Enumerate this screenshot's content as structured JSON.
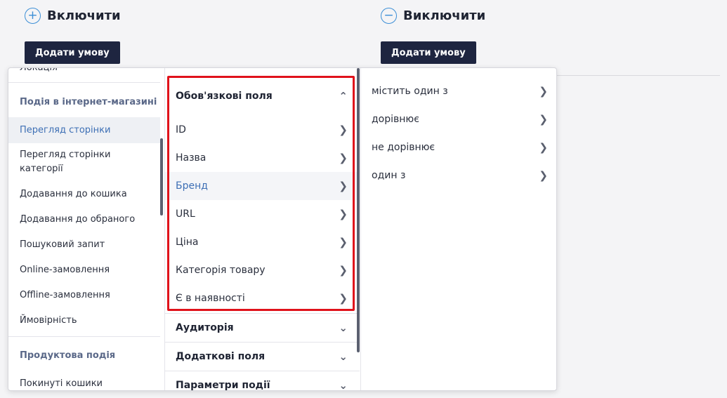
{
  "include": {
    "icon": "plus-circle-icon",
    "title": "Включити",
    "button": "Додати умову"
  },
  "exclude": {
    "icon": "minus-circle-icon",
    "title": "Виключити",
    "button": "Додати умову"
  },
  "column1": {
    "partial_top": "Локація",
    "group1": "Подія в інтернет-магазині",
    "items": [
      "Перегляд сторінки",
      "Перегляд сторінки категорії",
      "Додавання до кошика",
      "Додавання до обраного",
      "Пошуковий запит",
      "Online-замовлення",
      "Offline-замовлення",
      "Ймовірність"
    ],
    "selected": "Перегляд сторінки",
    "group2": "Продуктова подія",
    "items2": [
      "Покинуті кошики"
    ]
  },
  "column2": {
    "required_header": "Обов'язкові поля",
    "fields": [
      "ID",
      "Назва",
      "Бренд",
      "URL",
      "Ціна",
      "Категорія товару",
      "Є в наявності"
    ],
    "selected_field": "Бренд",
    "sections": [
      "Аудиторія",
      "Додаткові поля",
      "Параметри події"
    ]
  },
  "column3": {
    "operators": [
      "містить один з",
      "дорівнює",
      "не дорівнює",
      "один з"
    ]
  },
  "colors": {
    "accent": "#3d8fd6",
    "button_bg": "#1e2540",
    "highlight": "#e0121b",
    "selected_text": "#3d6fb5"
  }
}
